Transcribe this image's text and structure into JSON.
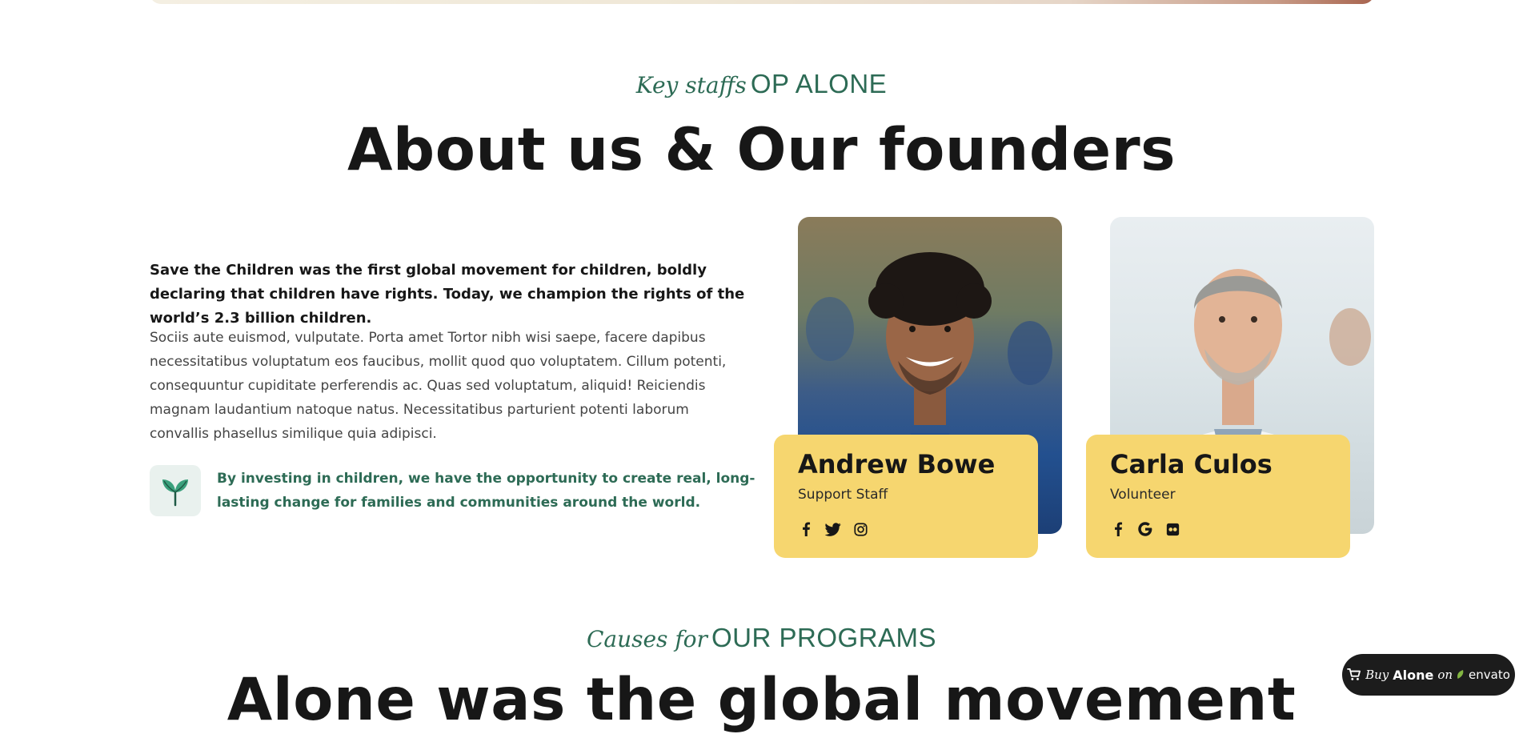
{
  "about": {
    "eyebrow_italic": "Key staffs",
    "eyebrow_caps": "OP ALONE",
    "title": "About us & Our founders",
    "intro_bold": "Save the Children was the first global movement for children, boldly declaring that children have rights. Today, we champion the rights of the world’s 2.3 billion children.",
    "body": "Sociis aute euismod, vulputate. Porta amet Tortor nibh wisi saepe, facere dapibus necessitatibus voluptatum eos faucibus, mollit quod quo voluptatem. Cillum potenti, consequuntur cupiditate perferendis ac. Quas sed voluptatum, aliquid! Reiciendis magnam laudantium natoque natus. Necessitatibus parturient potenti laborum convallis phasellus similique quia adipisci.",
    "highlight_icon": "sprout-icon",
    "highlight": "By investing in children, we have the opportunity to create real, long-lasting change for families and communities around the world."
  },
  "staff": [
    {
      "name": "Andrew Bowe",
      "role": "Support Staff",
      "socials": [
        "facebook-icon",
        "twitter-icon",
        "instagram-icon"
      ]
    },
    {
      "name": "Carla Culos",
      "role": "Volunteer",
      "socials": [
        "facebook-icon",
        "google-icon",
        "flickr-icon"
      ]
    }
  ],
  "programs": {
    "eyebrow_italic": "Causes for",
    "eyebrow_caps": "OUR PROGRAMS",
    "title": "Alone was the global movement"
  },
  "buy_button": {
    "icon": "cart-icon",
    "italic": "Buy",
    "brand": "Alone",
    "on": "on",
    "market": "envato"
  },
  "colors": {
    "accent_green": "#2d6b55",
    "card_yellow": "#f6d66f",
    "text_dark": "#171717"
  }
}
